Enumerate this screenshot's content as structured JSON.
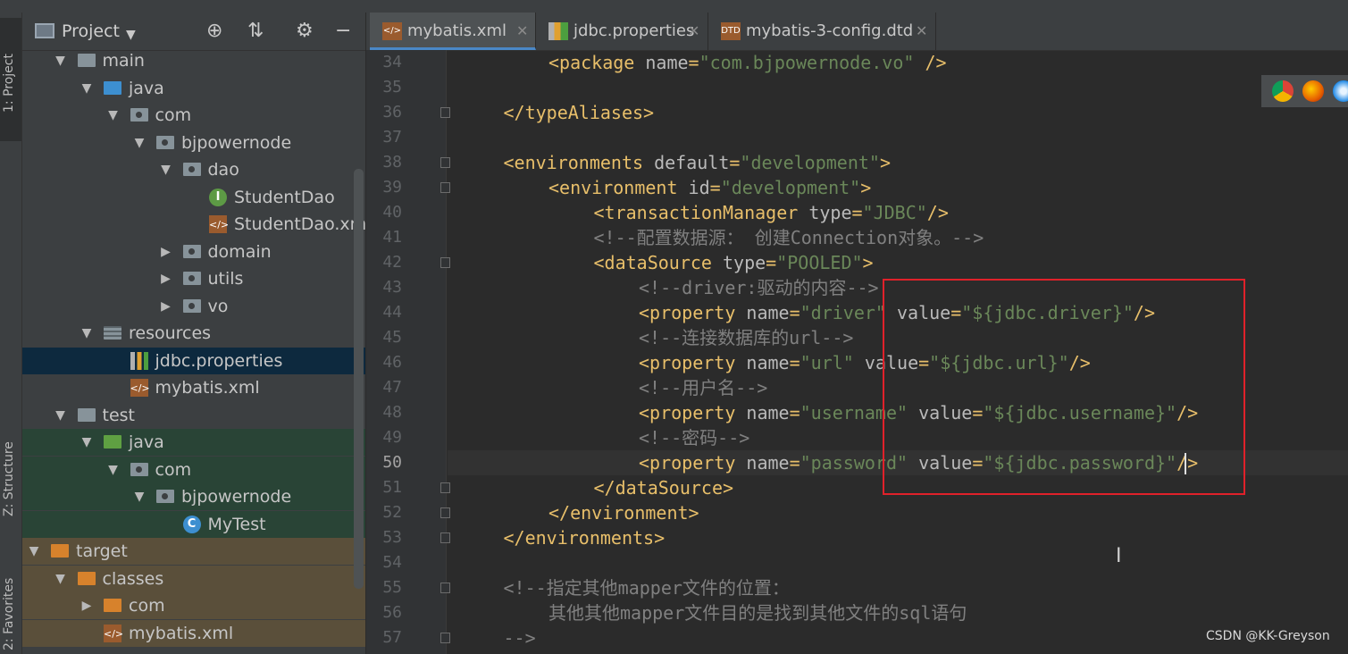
{
  "sidebar_tabs": {
    "project": "1: Project",
    "structure": "Z: Structure",
    "favorites": "2: Favorites"
  },
  "project_panel": {
    "title": "Project"
  },
  "tree": [
    {
      "label": "main",
      "indent": 1,
      "arrow": "▼",
      "icon": "folder-gray",
      "bg": ""
    },
    {
      "label": "java",
      "indent": 2,
      "arrow": "▼",
      "icon": "folder-blue",
      "bg": ""
    },
    {
      "label": "com",
      "indent": 3,
      "arrow": "▼",
      "icon": "package",
      "bg": ""
    },
    {
      "label": "bjpowernode",
      "indent": 4,
      "arrow": "▼",
      "icon": "package",
      "bg": ""
    },
    {
      "label": "dao",
      "indent": 5,
      "arrow": "▼",
      "icon": "package",
      "bg": ""
    },
    {
      "label": "StudentDao",
      "indent": 6,
      "arrow": "",
      "icon": "interface",
      "bg": ""
    },
    {
      "label": "StudentDao.xml",
      "indent": 6,
      "arrow": "",
      "icon": "xml",
      "bg": ""
    },
    {
      "label": "domain",
      "indent": 5,
      "arrow": "▶",
      "icon": "package",
      "bg": ""
    },
    {
      "label": "utils",
      "indent": 5,
      "arrow": "▶",
      "icon": "package",
      "bg": ""
    },
    {
      "label": "vo",
      "indent": 5,
      "arrow": "▶",
      "icon": "package",
      "bg": ""
    },
    {
      "label": "resources",
      "indent": 2,
      "arrow": "▼",
      "icon": "folder-res",
      "bg": ""
    },
    {
      "label": "jdbc.properties",
      "indent": 3,
      "arrow": "",
      "icon": "properties",
      "bg": "sel"
    },
    {
      "label": "mybatis.xml",
      "indent": 3,
      "arrow": "",
      "icon": "xml",
      "bg": ""
    },
    {
      "label": "test",
      "indent": 1,
      "arrow": "▼",
      "icon": "folder-gray",
      "bg": ""
    },
    {
      "label": "java",
      "indent": 2,
      "arrow": "▼",
      "icon": "folder-green",
      "bg": "grn"
    },
    {
      "label": "com",
      "indent": 3,
      "arrow": "▼",
      "icon": "package",
      "bg": "grn"
    },
    {
      "label": "bjpowernode",
      "indent": 4,
      "arrow": "▼",
      "icon": "package",
      "bg": "grn"
    },
    {
      "label": "MyTest",
      "indent": 5,
      "arrow": "",
      "icon": "class",
      "bg": "grn"
    },
    {
      "label": "target",
      "indent": 0,
      "arrow": "▼",
      "icon": "folder-orange",
      "bg": "tgt"
    },
    {
      "label": "classes",
      "indent": 1,
      "arrow": "▼",
      "icon": "folder-orange",
      "bg": "tgt"
    },
    {
      "label": "com",
      "indent": 2,
      "arrow": "▶",
      "icon": "folder-orange",
      "bg": "tgt"
    },
    {
      "label": "mybatis.xml",
      "indent": 2,
      "arrow": "",
      "icon": "xml",
      "bg": "tgt"
    }
  ],
  "tabs": [
    {
      "label": "mybatis.xml",
      "icon": "xml",
      "active": true
    },
    {
      "label": "jdbc.properties",
      "icon": "properties",
      "active": false
    },
    {
      "label": "mybatis-3-config.dtd",
      "icon": "dtd",
      "active": false
    }
  ],
  "code": [
    {
      "n": "34",
      "indent": 2,
      "fold": false,
      "tokens": [
        [
          "tg",
          "<package "
        ],
        [
          "at",
          "name"
        ],
        [
          "tg",
          "="
        ],
        [
          "av",
          "\"com.bjpowernode.vo\""
        ],
        [
          "tg",
          " />"
        ]
      ]
    },
    {
      "n": "35",
      "indent": 0,
      "fold": false,
      "tokens": []
    },
    {
      "n": "36",
      "indent": 1,
      "fold": true,
      "tokens": [
        [
          "tg",
          "</typeAliases>"
        ]
      ]
    },
    {
      "n": "37",
      "indent": 0,
      "fold": false,
      "tokens": []
    },
    {
      "n": "38",
      "indent": 1,
      "fold": true,
      "tokens": [
        [
          "tg",
          "<environments "
        ],
        [
          "at",
          "default"
        ],
        [
          "tg",
          "="
        ],
        [
          "av",
          "\"development\""
        ],
        [
          "tg",
          ">"
        ]
      ]
    },
    {
      "n": "39",
      "indent": 2,
      "fold": true,
      "tokens": [
        [
          "tg",
          "<environment "
        ],
        [
          "at",
          "id"
        ],
        [
          "tg",
          "="
        ],
        [
          "av",
          "\"development\""
        ],
        [
          "tg",
          ">"
        ]
      ]
    },
    {
      "n": "40",
      "indent": 3,
      "fold": false,
      "tokens": [
        [
          "tg",
          "<transactionManager "
        ],
        [
          "at",
          "type"
        ],
        [
          "tg",
          "="
        ],
        [
          "av",
          "\"JDBC\""
        ],
        [
          "tg",
          "/>"
        ]
      ]
    },
    {
      "n": "41",
      "indent": 3,
      "fold": false,
      "tokens": [
        [
          "cm",
          "<!--配置数据源： 创建Connection对象。-->"
        ]
      ]
    },
    {
      "n": "42",
      "indent": 3,
      "fold": true,
      "tokens": [
        [
          "tg",
          "<dataSource "
        ],
        [
          "at",
          "type"
        ],
        [
          "tg",
          "="
        ],
        [
          "av",
          "\"POOLED\""
        ],
        [
          "tg",
          ">"
        ]
      ]
    },
    {
      "n": "43",
      "indent": 4,
      "fold": false,
      "tokens": [
        [
          "cm",
          "<!--driver:驱动的内容-->"
        ]
      ]
    },
    {
      "n": "44",
      "indent": 4,
      "fold": false,
      "tokens": [
        [
          "tg",
          "<property "
        ],
        [
          "at",
          "name"
        ],
        [
          "tg",
          "="
        ],
        [
          "av",
          "\"driver\""
        ],
        [
          "at",
          " value"
        ],
        [
          "tg",
          "="
        ],
        [
          "av",
          "\"${jdbc.driver}\""
        ],
        [
          "tg",
          "/>"
        ]
      ]
    },
    {
      "n": "45",
      "indent": 4,
      "fold": false,
      "tokens": [
        [
          "cm",
          "<!--连接数据库的url-->"
        ]
      ]
    },
    {
      "n": "46",
      "indent": 4,
      "fold": false,
      "tokens": [
        [
          "tg",
          "<property "
        ],
        [
          "at",
          "name"
        ],
        [
          "tg",
          "="
        ],
        [
          "av",
          "\"url\""
        ],
        [
          "at",
          " value"
        ],
        [
          "tg",
          "="
        ],
        [
          "av",
          "\"${jdbc.url}\""
        ],
        [
          "tg",
          "/>"
        ]
      ]
    },
    {
      "n": "47",
      "indent": 4,
      "fold": false,
      "tokens": [
        [
          "cm",
          "<!--用户名-->"
        ]
      ]
    },
    {
      "n": "48",
      "indent": 4,
      "fold": false,
      "tokens": [
        [
          "tg",
          "<property "
        ],
        [
          "at",
          "name"
        ],
        [
          "tg",
          "="
        ],
        [
          "av",
          "\"username\""
        ],
        [
          "at",
          " value"
        ],
        [
          "tg",
          "="
        ],
        [
          "av",
          "\"${jdbc.username}\""
        ],
        [
          "tg",
          "/>"
        ]
      ]
    },
    {
      "n": "49",
      "indent": 4,
      "fold": false,
      "tokens": [
        [
          "cm",
          "<!--密码-->"
        ]
      ]
    },
    {
      "n": "50",
      "indent": 4,
      "fold": false,
      "current": true,
      "tokens": [
        [
          "tg",
          "<property "
        ],
        [
          "at",
          "name"
        ],
        [
          "tg",
          "="
        ],
        [
          "av",
          "\"password\""
        ],
        [
          "at",
          " value"
        ],
        [
          "tg",
          "="
        ],
        [
          "av",
          "\"${jdbc.password}\""
        ],
        [
          "tg",
          "/>"
        ]
      ]
    },
    {
      "n": "51",
      "indent": 3,
      "fold": true,
      "tokens": [
        [
          "tg",
          "</dataSource>"
        ]
      ]
    },
    {
      "n": "52",
      "indent": 2,
      "fold": true,
      "tokens": [
        [
          "tg",
          "</environment>"
        ]
      ]
    },
    {
      "n": "53",
      "indent": 1,
      "fold": true,
      "tokens": [
        [
          "tg",
          "</environments>"
        ]
      ]
    },
    {
      "n": "54",
      "indent": 0,
      "fold": false,
      "tokens": []
    },
    {
      "n": "55",
      "indent": 1,
      "fold": true,
      "tokens": [
        [
          "cm",
          "<!--指定其他mapper文件的位置："
        ]
      ]
    },
    {
      "n": "56",
      "indent": 2,
      "fold": false,
      "tokens": [
        [
          "cm",
          "其他其他mapper文件目的是找到其他文件的sql语句"
        ]
      ]
    },
    {
      "n": "57",
      "indent": 1,
      "fold": true,
      "tokens": [
        [
          "cm",
          "-->"
        ]
      ]
    }
  ],
  "browser_icons": [
    "chrome-icon",
    "firefox-icon",
    "safari-icon"
  ],
  "watermark": "CSDN @KK-Greyson",
  "colors": {
    "tag": "#e8bf6a",
    "attr": "#bababa",
    "value": "#6a8759",
    "comment": "#808080",
    "highlight_box": "#e0212a"
  }
}
